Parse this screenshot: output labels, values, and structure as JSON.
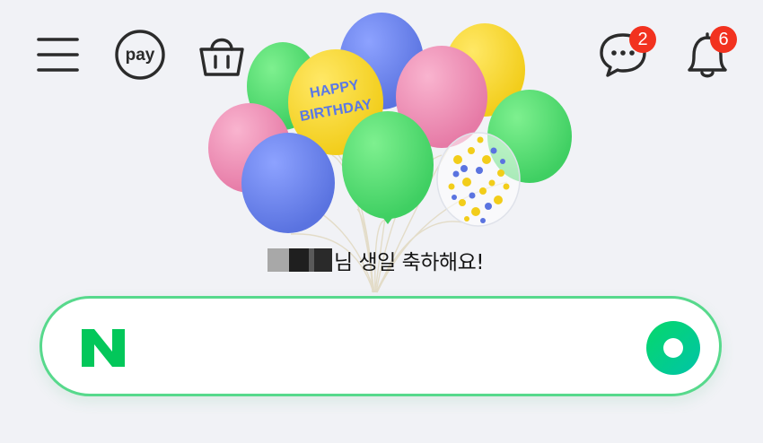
{
  "header": {
    "menu_icon": "hamburger-menu-icon",
    "pay_label": "pay",
    "shopping_icon": "shopping-bag-icon",
    "talk": {
      "icon": "talk-chat-bubble-icon",
      "badge_count": "2"
    },
    "notifications": {
      "icon": "bell-icon",
      "badge_count": "6"
    }
  },
  "banner": {
    "balloon_text": "HAPPY BIRTHDAY",
    "greeting": "님 생일 축하해요!"
  },
  "search": {
    "logo_letter": "N",
    "placeholder": "",
    "value": "",
    "action_icon": "green-circle-icon"
  },
  "colors": {
    "brand_green": "#03c75a",
    "search_border": "#57d98c",
    "badge_red": "#f2321f",
    "background": "#f1f2f6",
    "icon_dark": "#2b2b2b"
  }
}
